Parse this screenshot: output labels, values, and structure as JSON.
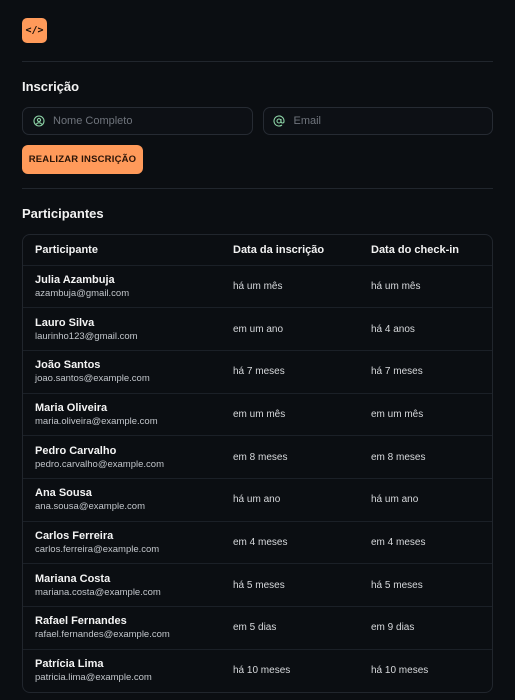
{
  "logo": {
    "glyph": "</>"
  },
  "signup": {
    "title": "Inscrição",
    "name_placeholder": "Nome Completo",
    "email_placeholder": "Email",
    "submit_label": "REALIZAR INSCRIÇÃO"
  },
  "participants": {
    "title": "Participantes",
    "columns": [
      "Participante",
      "Data da inscrição",
      "Data do check-in"
    ],
    "rows": [
      {
        "name": "Julia Azambuja",
        "email": "azambuja@gmail.com",
        "registered": "há um mês",
        "checkin": "há um mês"
      },
      {
        "name": "Lauro Silva",
        "email": "laurinho123@gmail.com",
        "registered": "em um ano",
        "checkin": "há 4 anos"
      },
      {
        "name": "João Santos",
        "email": "joao.santos@example.com",
        "registered": "há 7 meses",
        "checkin": "há 7 meses"
      },
      {
        "name": "Maria Oliveira",
        "email": "maria.oliveira@example.com",
        "registered": "em um mês",
        "checkin": "em um mês"
      },
      {
        "name": "Pedro Carvalho",
        "email": "pedro.carvalho@example.com",
        "registered": "em 8 meses",
        "checkin": "em 8 meses"
      },
      {
        "name": "Ana Sousa",
        "email": "ana.sousa@example.com",
        "registered": "há um ano",
        "checkin": "há um ano"
      },
      {
        "name": "Carlos Ferreira",
        "email": "carlos.ferreira@example.com",
        "registered": "em 4 meses",
        "checkin": "em 4 meses"
      },
      {
        "name": "Mariana Costa",
        "email": "mariana.costa@example.com",
        "registered": "há 5 meses",
        "checkin": "há 5 meses"
      },
      {
        "name": "Rafael Fernandes",
        "email": "rafael.fernandes@example.com",
        "registered": "em 5 dias",
        "checkin": "em 9 dias"
      },
      {
        "name": "Patrícia Lima",
        "email": "patricia.lima@example.com",
        "registered": "há 10 meses",
        "checkin": "há 10 meses"
      }
    ]
  },
  "colors": {
    "accent": "#ff9a5a",
    "background": "#0b0e12",
    "icon": "#8cd3a6"
  }
}
